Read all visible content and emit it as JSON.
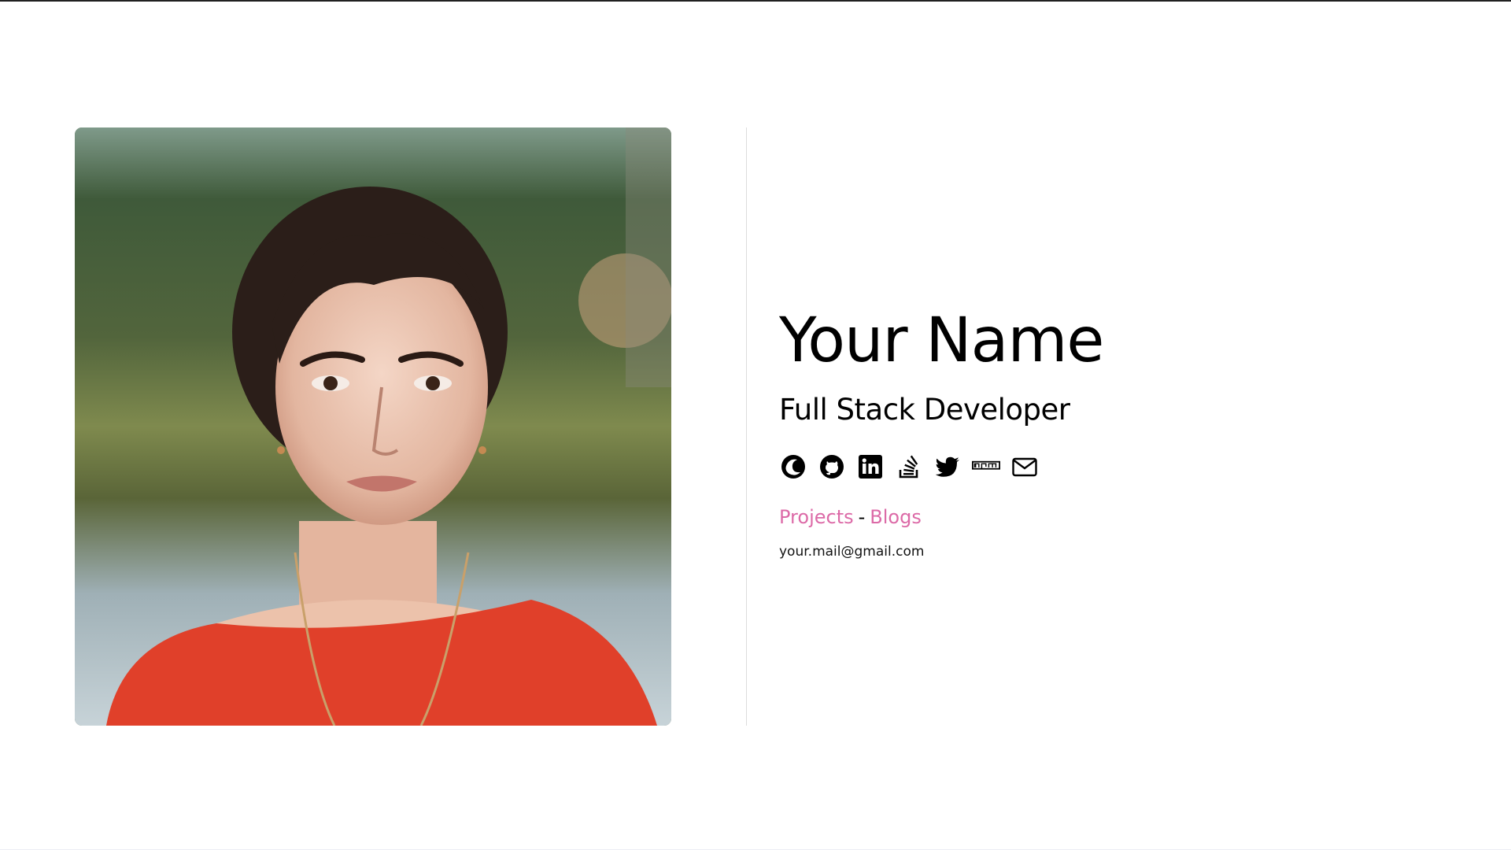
{
  "profile": {
    "name": "Your Name",
    "role": "Full Stack Developer",
    "photo_alt": "portrait-photo"
  },
  "socials": [
    {
      "icon": "personal-site-icon"
    },
    {
      "icon": "github-icon"
    },
    {
      "icon": "linkedin-icon"
    },
    {
      "icon": "stackoverflow-icon"
    },
    {
      "icon": "twitter-icon"
    },
    {
      "icon": "npm-icon"
    },
    {
      "icon": "mail-icon"
    }
  ],
  "links": {
    "projects": "Projects",
    "separator": "-",
    "blogs": "Blogs"
  },
  "contact": {
    "email": "your.mail@gmail.com"
  },
  "colors": {
    "link": "#dc6aa7",
    "text": "#000000",
    "background": "#ffffff"
  }
}
